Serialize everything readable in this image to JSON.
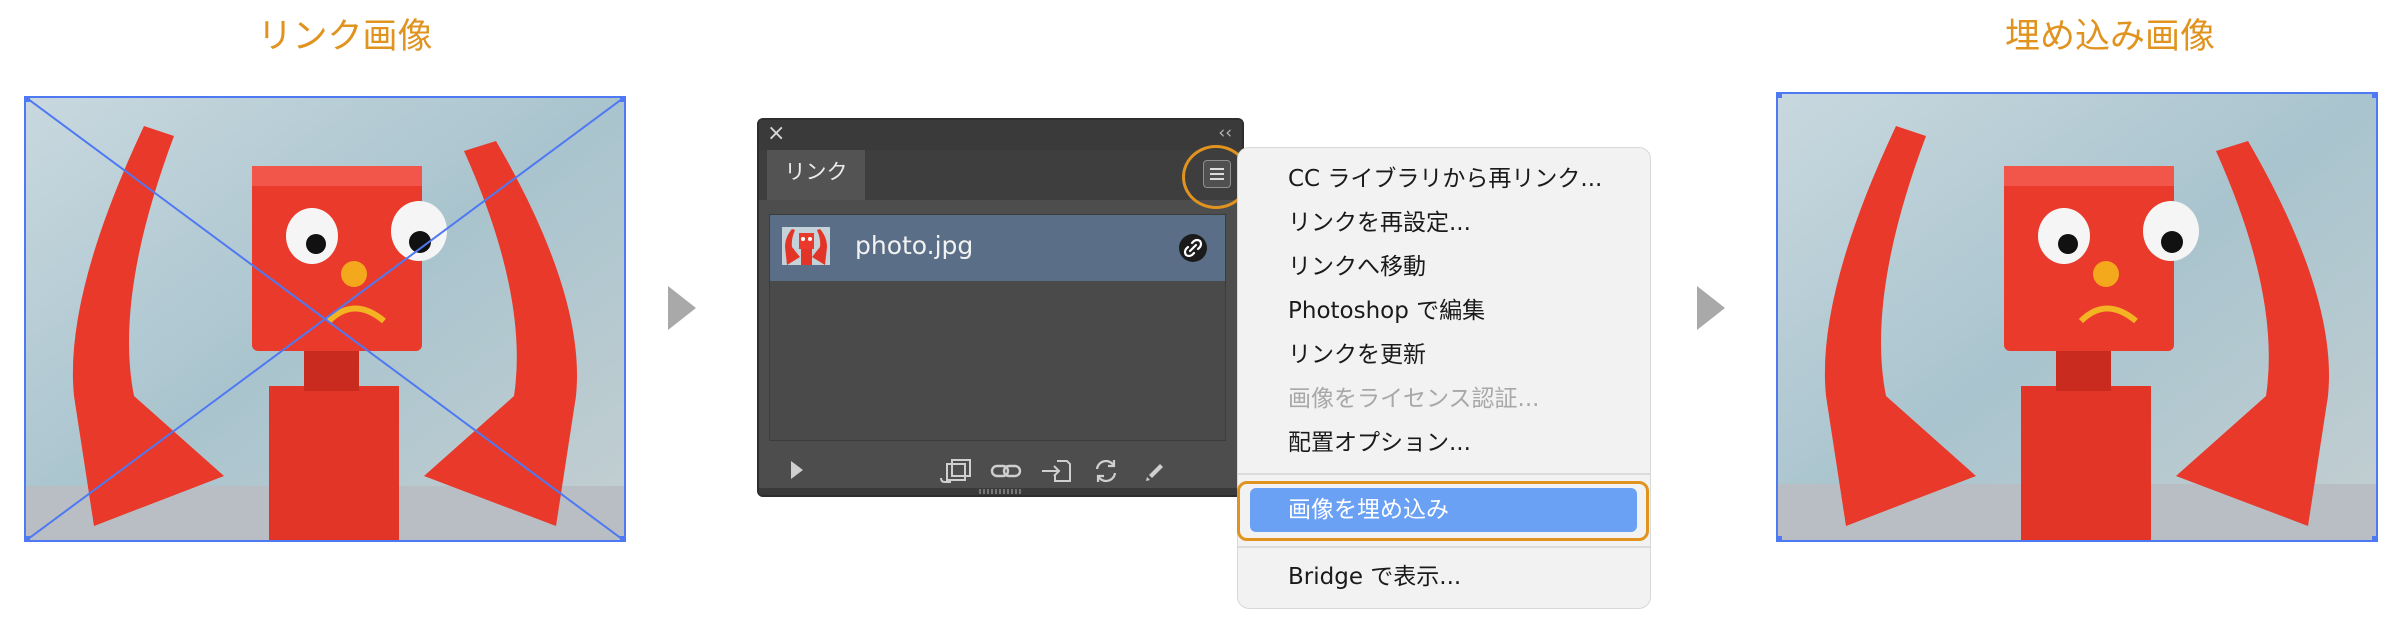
{
  "captions": {
    "left": "リンク画像",
    "right": "埋め込み画像"
  },
  "panel": {
    "close_glyph": "×",
    "collapse_glyph": "‹‹",
    "tab_label": "リンク",
    "file_name": "photo.jpg"
  },
  "menu": {
    "items": [
      {
        "label": "CC ライブラリから再リンク...",
        "enabled": true
      },
      {
        "label": "リンクを再設定...",
        "enabled": true
      },
      {
        "label": "リンクへ移動",
        "enabled": true
      },
      {
        "label": "Photoshop で編集",
        "enabled": true
      },
      {
        "label": "リンクを更新",
        "enabled": true
      },
      {
        "label": "画像をライセンス認証...",
        "enabled": false
      },
      {
        "label": "配置オプション...",
        "enabled": true
      },
      {
        "label": "画像を埋め込み",
        "enabled": true,
        "selected": true
      },
      {
        "label": "Bridge で表示...",
        "enabled": true
      }
    ]
  },
  "colors": {
    "accent": "#e0931e",
    "selection_blue": "#6aa1f5",
    "bbox_blue": "#4f79f2",
    "panel_bg": "#4d4d4d",
    "row_selected": "#5b6e87"
  },
  "icons": [
    "play-icon",
    "relink-cc-icon",
    "link-icon",
    "goto-link-icon",
    "update-icon",
    "edit-original-icon",
    "panel-menu-icon",
    "linked-file-icon",
    "close-icon"
  ]
}
